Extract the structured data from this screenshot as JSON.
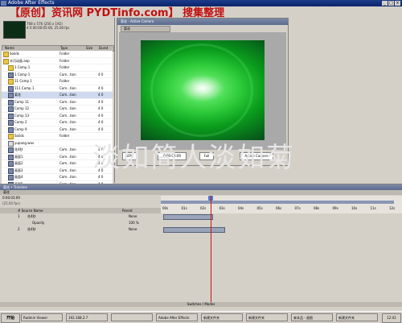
{
  "app": {
    "title": "Adobe After Effects"
  },
  "watermark": {
    "top": "【原创】资讯网 PYDTinfo.com】 搜集整理",
    "center": "淡如简人淡如菊"
  },
  "project": {
    "info_lines": [
      "768 x 576  (256 x 192)",
      "4 0 00:00:05:00, 25.00 fps"
    ],
    "headers": {
      "name": "Name",
      "type": "Type",
      "size": "Size",
      "dur": "Durat"
    },
    "items": [
      {
        "name": "Solids",
        "type": "Folder",
        "size": "",
        "icon": "folder-icon"
      },
      {
        "name": "丰月动画.aep",
        "type": "Folder",
        "size": "",
        "icon": "folder-icon"
      },
      {
        "name": "1 Comp 1",
        "type": "Folder",
        "size": "",
        "icon": "folder-icon"
      },
      {
        "name": "1 Comp 1",
        "type": "Com...tion",
        "size": "4 0",
        "icon": "comp-icon"
      },
      {
        "name": "11 Comp 1",
        "type": "Folder",
        "size": "",
        "icon": "folder-icon"
      },
      {
        "name": "111 Comp 1",
        "type": "Com...tion",
        "size": "4 0",
        "icon": "comp-icon"
      },
      {
        "name": "菊花",
        "type": "Com...tion",
        "size": "4 0",
        "icon": "comp-icon",
        "selected": true
      },
      {
        "name": "Comp 11",
        "type": "Com...tion",
        "size": "4 0",
        "icon": "comp-icon"
      },
      {
        "name": "Comp 12",
        "type": "Com...tion",
        "size": "4 0",
        "icon": "comp-icon"
      },
      {
        "name": "Comp 13",
        "type": "Com...tion",
        "size": "4 0",
        "icon": "comp-icon"
      },
      {
        "name": "Comp 2",
        "type": "Com...tion",
        "size": "4 0",
        "icon": "comp-icon"
      },
      {
        "name": "Comp 9",
        "type": "Com...tion",
        "size": "4 0",
        "icon": "comp-icon"
      },
      {
        "name": "Solids",
        "type": "Folder",
        "size": "",
        "icon": "folder-icon"
      },
      {
        "name": "yupang.wav",
        "type": "",
        "size": "",
        "icon": "file-icon"
      },
      {
        "name": "花4秒",
        "type": "Com...tion",
        "size": "4 0",
        "icon": "comp-icon"
      },
      {
        "name": "画面1",
        "type": "Com...tion",
        "size": "4 0",
        "icon": "comp-icon"
      },
      {
        "name": "画面2",
        "type": "Com...tion",
        "size": "4 0",
        "icon": "comp-icon"
      },
      {
        "name": "画面3",
        "type": "Com...tion",
        "size": "4 0",
        "icon": "comp-icon"
      },
      {
        "name": "画面4",
        "type": "Com...tion",
        "size": "4 0",
        "icon": "comp-icon"
      },
      {
        "name": "画面5",
        "type": "Com...tion",
        "size": "4 0",
        "icon": "comp-icon"
      },
      {
        "name": "画面02上的圈",
        "type": "Com...tion",
        "size": "4 0",
        "icon": "comp-icon"
      },
      {
        "name": "绿色. tc+4839",
        "type": "Vid...ovie",
        "size": "7 0",
        "icon": "file-icon"
      }
    ]
  },
  "comp": {
    "title": "菊花 - Active Camera",
    "tab": "菊花",
    "zoom": "50%",
    "time": "0:00:03:09",
    "res": "Full",
    "camera": "Active Camera"
  },
  "timeline": {
    "title": "菊花 • Timeline",
    "tab": "菊花",
    "time": "0:00:03:09",
    "fps": "(25.00 fps)",
    "col_layer": "# Source Name",
    "col_parent": "Parent",
    "ruler_ticks": [
      "00s",
      "01s",
      "02s",
      "03s",
      "04s",
      "05s",
      "06s",
      "07s",
      "08s",
      "09s",
      "10s",
      "11s",
      "12s"
    ],
    "layers": [
      {
        "num": "1",
        "name": "花4秒",
        "parent": "None"
      },
      {
        "num": "",
        "name": "Opacity",
        "parent": "100 %"
      },
      {
        "num": "2",
        "name": "花4秒",
        "parent": "None"
      }
    ],
    "switches_label": "Switches / Modes"
  },
  "taskbar": {
    "start": "开始",
    "tasks": [
      "Radmin Viewer",
      "192.168.2.7",
      "",
      "Adobe After Effects",
      "新建文件夹",
      "新建文件夹",
      "来本品 - 画图",
      "新建文件夹"
    ],
    "clock": "12:41"
  }
}
